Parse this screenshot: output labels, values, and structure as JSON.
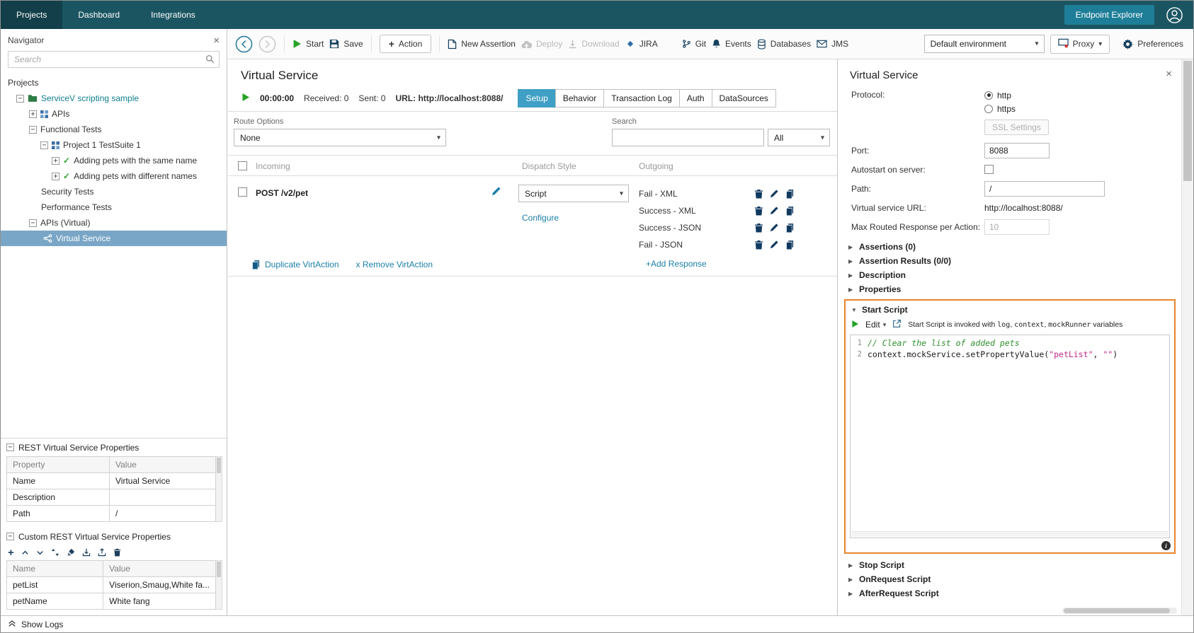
{
  "icons": {
    "close": "×",
    "caret_down": "▾",
    "collapsed": "▶",
    "expanded": "▼",
    "check": "✓",
    "plus": "+",
    "info": "i",
    "expander_open": "−",
    "expander_closed": "+"
  },
  "colors": {
    "topbar_bg": "#1b5562",
    "accent_teal_button": "#1e7e98",
    "link_teal": "#1b7fa8",
    "active_tab_blue": "#3f9fc4",
    "tree_selection_bg": "#79a6c6",
    "highlight_orange": "#e8842c",
    "play_green": "#25a325",
    "icon_navy": "#15405f",
    "code_comment_green": "#2f8f2f",
    "code_string_magenta": "#c22a8a"
  },
  "topbar": {
    "tabs": [
      "Projects",
      "Dashboard",
      "Integrations"
    ],
    "endpoint_explorer": "Endpoint Explorer"
  },
  "toolbar": {
    "start": "Start",
    "save": "Save",
    "action": "Action",
    "new_assertion": "New Assertion",
    "deploy": "Deploy",
    "download": "Download",
    "jira": "JIRA",
    "git": "Git",
    "events": "Events",
    "databases": "Databases",
    "jms": "JMS",
    "environment": "Default environment",
    "proxy": "Proxy",
    "preferences": "Preferences"
  },
  "navigator": {
    "title": "Navigator",
    "search_placeholder": "Search",
    "projects_root": "Projects",
    "tree": {
      "project": "ServiceV scripting sample",
      "apis": "APIs",
      "functional": "Functional Tests",
      "suite": "Project 1 TestSuite 1",
      "test_same": "Adding pets with the same name",
      "test_diff": "Adding pets with different names",
      "security": "Security Tests",
      "performance": "Performance Tests",
      "apis_virtual": "APIs (Virtual)",
      "virtual_service": "Virtual Service"
    },
    "rest_properties": {
      "title": "REST Virtual Service Properties",
      "col_property": "Property",
      "col_value": "Value",
      "rows": [
        {
          "property": "Name",
          "value": "Virtual Service"
        },
        {
          "property": "Description",
          "value": ""
        },
        {
          "property": "Path",
          "value": "/"
        }
      ]
    },
    "custom_properties": {
      "title": "Custom REST Virtual Service Properties",
      "col_name": "Name",
      "col_value": "Value",
      "rows": [
        {
          "name": "petList",
          "value": "Viserion,Smaug,White fa..."
        },
        {
          "name": "petName",
          "value": "White fang"
        }
      ]
    },
    "show_logs": "Show Logs"
  },
  "main": {
    "title": "Virtual Service",
    "timer": "00:00:00",
    "received": "Received: 0",
    "sent": "Sent: 0",
    "url": "URL: http://localhost:8088/",
    "tabs": [
      "Setup",
      "Behavior",
      "Transaction Log",
      "Auth",
      "DataSources"
    ],
    "route_options_label": "Route Options",
    "route_options_value": "None",
    "search_label": "Search",
    "search_filter_value": "All",
    "columns": {
      "incoming": "Incoming",
      "dispatch": "Dispatch Style",
      "outgoing": "Outgoing"
    },
    "virt_action": {
      "method_path": "POST /v2/pet",
      "dispatch_style": "Script",
      "configure_link": "Configure",
      "responses": [
        "Fail - XML",
        "Success - XML",
        "Success - JSON",
        "Fail - JSON"
      ],
      "add_response_link": "+Add Response"
    },
    "duplicate_link": "Duplicate VirtAction",
    "remove_link": "x Remove VirtAction"
  },
  "panel": {
    "title": "Virtual Service",
    "protocol_label": "Protocol:",
    "protocol_http": "http",
    "protocol_https": "https",
    "ssl_settings_button": "SSL Settings",
    "port_label": "Port:",
    "port_value": "8088",
    "autostart_label": "Autostart on server:",
    "path_label": "Path:",
    "path_value": "/",
    "url_label": "Virtual service URL:",
    "url_value": "http://localhost:8088/",
    "max_routed_label": "Max Routed Response per Action:",
    "max_routed_value": "10",
    "sections_collapsed_top": [
      "Assertions (0)",
      "Assertion Results (0/0)",
      "Description",
      "Properties"
    ],
    "start_script": {
      "title": "Start Script",
      "edit_button": "Edit",
      "hint": {
        "prefix": "Start Script is invoked with ",
        "var1": "log",
        "sep1": ", ",
        "var2": "context",
        "sep2": ", ",
        "var3": "mockRunner",
        "suffix": " variables"
      },
      "code": {
        "line1_number": "1",
        "line1_comment": "// Clear the list of added pets",
        "line2_number": "2",
        "line2_pre": "context.mockService.setPropertyValue(",
        "line2_str1": "\"petList\"",
        "line2_mid": ", ",
        "line2_str2": "\"\"",
        "line2_post": ")"
      }
    },
    "sections_collapsed_bottom": [
      "Stop Script",
      "OnRequest Script",
      "AfterRequest Script"
    ]
  }
}
